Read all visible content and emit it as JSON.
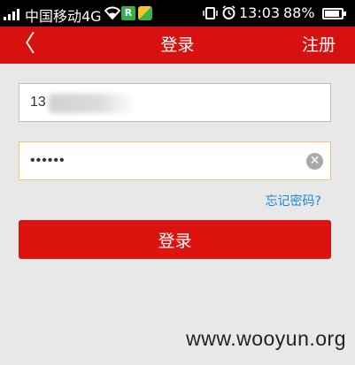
{
  "status_bar": {
    "carrier": "中国移动4G",
    "app_r": "R",
    "time": "13:03",
    "battery": "88%",
    "battery_level": 0.88
  },
  "nav": {
    "back_icon": "chevron-left-icon",
    "back_glyph": "〈",
    "title": "登录",
    "register": "注册"
  },
  "form": {
    "phone_value": "13",
    "password_value": "••••••",
    "clear_glyph": "✕",
    "forgot": "忘记密码?",
    "login": "登录"
  },
  "watermark": "www.wooyun.org",
  "colors": {
    "brand_red": "#d7110f",
    "link_blue": "#1b86d8",
    "focus_border": "#f2c272"
  }
}
